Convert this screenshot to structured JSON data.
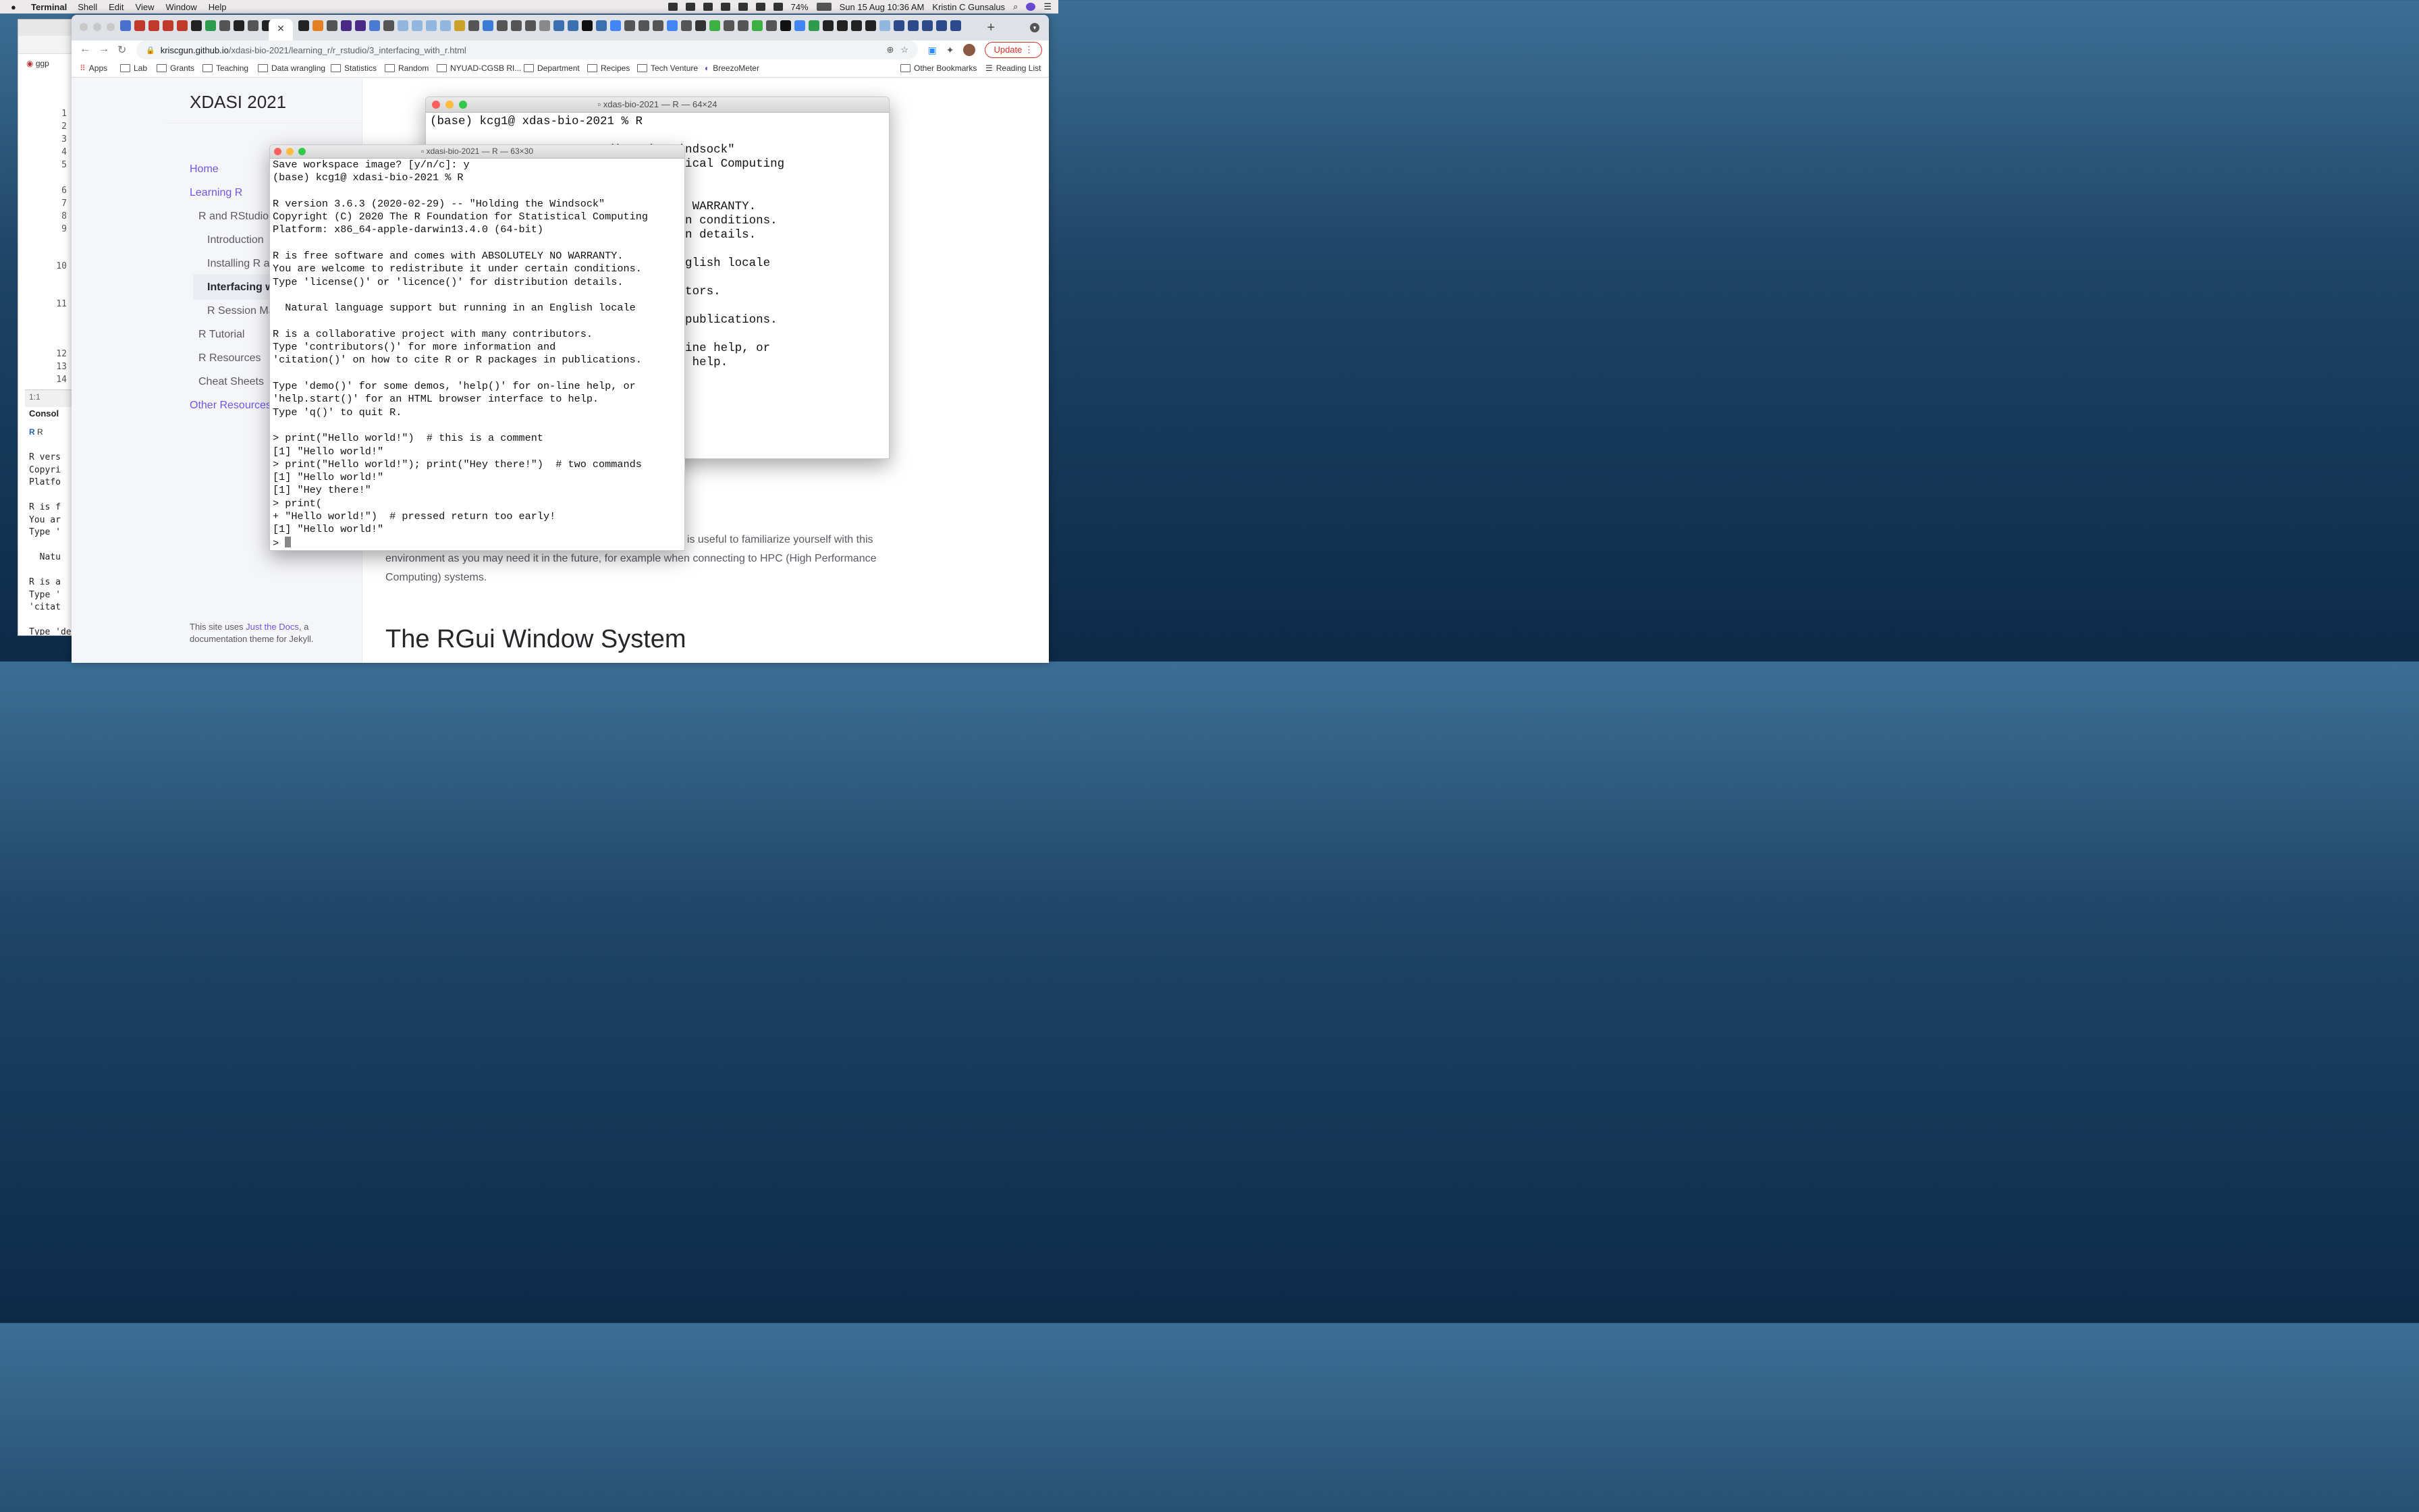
{
  "menubar": {
    "app_name": "Terminal",
    "items": [
      "Shell",
      "Edit",
      "View",
      "Window",
      "Help"
    ],
    "battery": "74%",
    "datetime": "Sun 15 Aug  10:36 AM",
    "user": "Kristin C Gunsalus"
  },
  "rstudio": {
    "tab_label": "ggp",
    "line_numbers": [
      "1",
      "2",
      "3",
      "4",
      "5",
      "6",
      "7",
      "8",
      "9",
      "10",
      "11",
      "12",
      "13",
      "14"
    ],
    "cursor_pos": "1:1",
    "console_tab": "Consol",
    "console_r_label": "R",
    "console_lines": [
      "R vers",
      "Copyri",
      "Platfo",
      "",
      "R is f",
      "You ar",
      "Type '",
      "",
      "  Natu",
      "",
      "R is a",
      "Type '",
      "'citat",
      "",
      "Type 'de"
    ]
  },
  "browser": {
    "url_host": "kriscgun.github.io",
    "url_path": "/xdasi-bio-2021/learning_r/r_rstudio/3_interfacing_with_r.html",
    "update_label": "Update",
    "bookmarks": [
      "Apps",
      "Lab",
      "Grants",
      "Teaching",
      "Data wrangling",
      "Statistics",
      "Random",
      "NYUAD-CGSB RI...",
      "Department",
      "Recipes",
      "Tech Venture",
      "BreezoMeter"
    ],
    "other_bookmarks": "Other Bookmarks",
    "reading_list": "Reading List"
  },
  "site": {
    "title": "XDASI 2021",
    "nav": {
      "home": "Home",
      "learning_r": "Learning R",
      "r_and_rstudio": "R and RStudio",
      "introduction": "Introduction",
      "installing": "Installing R ar",
      "interfacing": "Interfacing w",
      "session": "R Session Ma",
      "tutorial": "R Tutorial",
      "resources": "R Resources",
      "cheat_sheets": "Cheat Sheets",
      "other_resources": "Other Resources"
    },
    "footer_prefix": "This site uses ",
    "footer_link": "Just the Docs",
    "footer_suffix": ", a documentation theme for Jekyll.",
    "paragraph": "R, it is useful to familiarize yourself with this environment as you may need it in the future, for example when connecting to HPC (High Performance Computing) systems.",
    "heading": "The RGui Window System"
  },
  "terminal_back": {
    "title": "xdas-bio-2021 — R — 64×24",
    "text": "(base) kcg1@ xdas-bio-2021 % R\n\n                         ding the Windsock\"\n                         for Statistical Computing\n                         (64-bit)\n\n                         SOLUTELY NO WARRANTY.\n                         nder certain conditions.\n                         distribution details.\n\n                         ng in an English locale\n\n                         ny contributors.\n                         rmation and\n                         ackages in publications.\n\n                         )' for on-line help, or\n                         nterface to help."
  },
  "terminal_front": {
    "title": "xdasi-bio-2021 — R — 63×30",
    "text": "Save workspace image? [y/n/c]: y\n(base) kcg1@ xdasi-bio-2021 % R\n\nR version 3.6.3 (2020-02-29) -- \"Holding the Windsock\"\nCopyright (C) 2020 The R Foundation for Statistical Computing\nPlatform: x86_64-apple-darwin13.4.0 (64-bit)\n\nR is free software and comes with ABSOLUTELY NO WARRANTY.\nYou are welcome to redistribute it under certain conditions.\nType 'license()' or 'licence()' for distribution details.\n\n  Natural language support but running in an English locale\n\nR is a collaborative project with many contributors.\nType 'contributors()' for more information and\n'citation()' on how to cite R or R packages in publications.\n\nType 'demo()' for some demos, 'help()' for on-line help, or\n'help.start()' for an HTML browser interface to help.\nType 'q()' to quit R.\n\n> print(\"Hello world!\")  # this is a comment\n[1] \"Hello world!\"\n> print(\"Hello world!\"); print(\"Hey there!\")  # two commands\n[1] \"Hello world!\"\n[1] \"Hey there!\"\n> print(\n+ \"Hello world!\")  # pressed return too early!\n[1] \"Hello world!\"",
    "prompt": "> "
  }
}
